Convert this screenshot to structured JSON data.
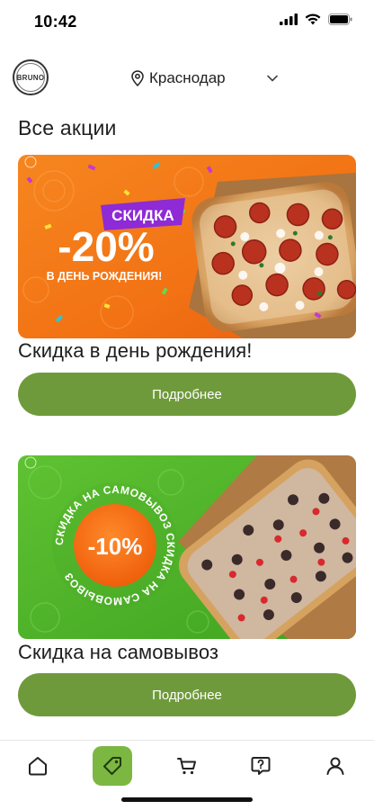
{
  "status_bar": {
    "time": "10:42"
  },
  "header": {
    "logo_text": "BRUNO",
    "city": "Краснодар"
  },
  "page": {
    "title": "Все акции"
  },
  "promos": [
    {
      "banner_badge": "СКИДКА",
      "banner_value": "-20%",
      "banner_caption": "В ДЕНЬ РОЖДЕНИЯ!",
      "title": "Скидка в день рождения!",
      "button_label": "Подробнее",
      "bg_color": "#f07a1a"
    },
    {
      "banner_value": "-10%",
      "banner_ring_text": "СКИДКА НА САМОВЫВОЗ СКИДКА НА САМОВЫВОЗ",
      "title": "Скидка на самовывоз",
      "button_label": "Подробнее",
      "bg_color": "#56b82c"
    }
  ],
  "tab_bar": {
    "items": [
      {
        "icon": "home-icon"
      },
      {
        "icon": "tag-icon",
        "active": true
      },
      {
        "icon": "cart-icon"
      },
      {
        "icon": "help-icon"
      },
      {
        "icon": "profile-icon"
      }
    ]
  },
  "colors": {
    "accent": "#7cb742",
    "button": "#6f9a3b"
  }
}
